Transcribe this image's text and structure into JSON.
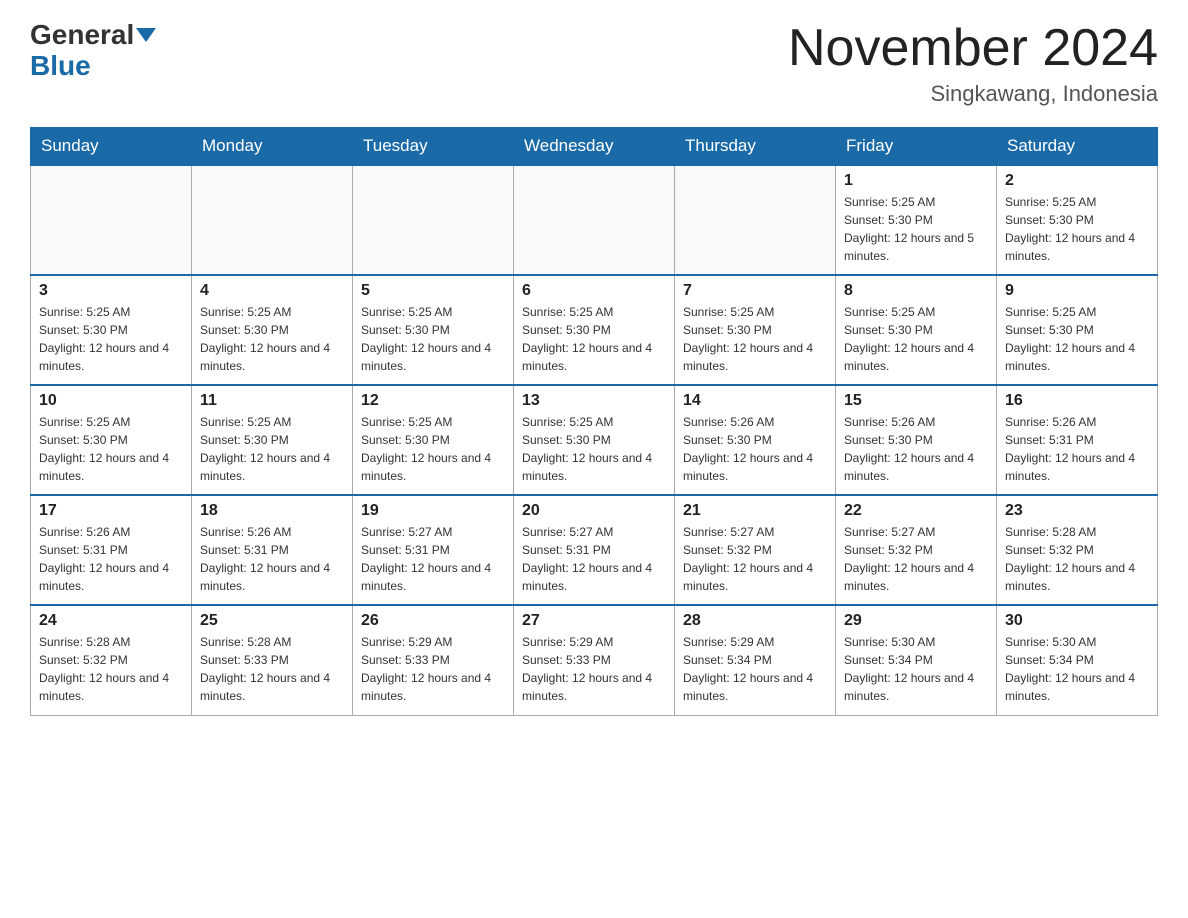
{
  "logo": {
    "general": "General",
    "blue": "Blue"
  },
  "header": {
    "title": "November 2024",
    "location": "Singkawang, Indonesia"
  },
  "weekdays": [
    "Sunday",
    "Monday",
    "Tuesday",
    "Wednesday",
    "Thursday",
    "Friday",
    "Saturday"
  ],
  "weeks": [
    [
      {
        "day": "",
        "sunrise": "",
        "sunset": "",
        "daylight": ""
      },
      {
        "day": "",
        "sunrise": "",
        "sunset": "",
        "daylight": ""
      },
      {
        "day": "",
        "sunrise": "",
        "sunset": "",
        "daylight": ""
      },
      {
        "day": "",
        "sunrise": "",
        "sunset": "",
        "daylight": ""
      },
      {
        "day": "",
        "sunrise": "",
        "sunset": "",
        "daylight": ""
      },
      {
        "day": "1",
        "sunrise": "Sunrise: 5:25 AM",
        "sunset": "Sunset: 5:30 PM",
        "daylight": "Daylight: 12 hours and 5 minutes."
      },
      {
        "day": "2",
        "sunrise": "Sunrise: 5:25 AM",
        "sunset": "Sunset: 5:30 PM",
        "daylight": "Daylight: 12 hours and 4 minutes."
      }
    ],
    [
      {
        "day": "3",
        "sunrise": "Sunrise: 5:25 AM",
        "sunset": "Sunset: 5:30 PM",
        "daylight": "Daylight: 12 hours and 4 minutes."
      },
      {
        "day": "4",
        "sunrise": "Sunrise: 5:25 AM",
        "sunset": "Sunset: 5:30 PM",
        "daylight": "Daylight: 12 hours and 4 minutes."
      },
      {
        "day": "5",
        "sunrise": "Sunrise: 5:25 AM",
        "sunset": "Sunset: 5:30 PM",
        "daylight": "Daylight: 12 hours and 4 minutes."
      },
      {
        "day": "6",
        "sunrise": "Sunrise: 5:25 AM",
        "sunset": "Sunset: 5:30 PM",
        "daylight": "Daylight: 12 hours and 4 minutes."
      },
      {
        "day": "7",
        "sunrise": "Sunrise: 5:25 AM",
        "sunset": "Sunset: 5:30 PM",
        "daylight": "Daylight: 12 hours and 4 minutes."
      },
      {
        "day": "8",
        "sunrise": "Sunrise: 5:25 AM",
        "sunset": "Sunset: 5:30 PM",
        "daylight": "Daylight: 12 hours and 4 minutes."
      },
      {
        "day": "9",
        "sunrise": "Sunrise: 5:25 AM",
        "sunset": "Sunset: 5:30 PM",
        "daylight": "Daylight: 12 hours and 4 minutes."
      }
    ],
    [
      {
        "day": "10",
        "sunrise": "Sunrise: 5:25 AM",
        "sunset": "Sunset: 5:30 PM",
        "daylight": "Daylight: 12 hours and 4 minutes."
      },
      {
        "day": "11",
        "sunrise": "Sunrise: 5:25 AM",
        "sunset": "Sunset: 5:30 PM",
        "daylight": "Daylight: 12 hours and 4 minutes."
      },
      {
        "day": "12",
        "sunrise": "Sunrise: 5:25 AM",
        "sunset": "Sunset: 5:30 PM",
        "daylight": "Daylight: 12 hours and 4 minutes."
      },
      {
        "day": "13",
        "sunrise": "Sunrise: 5:25 AM",
        "sunset": "Sunset: 5:30 PM",
        "daylight": "Daylight: 12 hours and 4 minutes."
      },
      {
        "day": "14",
        "sunrise": "Sunrise: 5:26 AM",
        "sunset": "Sunset: 5:30 PM",
        "daylight": "Daylight: 12 hours and 4 minutes."
      },
      {
        "day": "15",
        "sunrise": "Sunrise: 5:26 AM",
        "sunset": "Sunset: 5:30 PM",
        "daylight": "Daylight: 12 hours and 4 minutes."
      },
      {
        "day": "16",
        "sunrise": "Sunrise: 5:26 AM",
        "sunset": "Sunset: 5:31 PM",
        "daylight": "Daylight: 12 hours and 4 minutes."
      }
    ],
    [
      {
        "day": "17",
        "sunrise": "Sunrise: 5:26 AM",
        "sunset": "Sunset: 5:31 PM",
        "daylight": "Daylight: 12 hours and 4 minutes."
      },
      {
        "day": "18",
        "sunrise": "Sunrise: 5:26 AM",
        "sunset": "Sunset: 5:31 PM",
        "daylight": "Daylight: 12 hours and 4 minutes."
      },
      {
        "day": "19",
        "sunrise": "Sunrise: 5:27 AM",
        "sunset": "Sunset: 5:31 PM",
        "daylight": "Daylight: 12 hours and 4 minutes."
      },
      {
        "day": "20",
        "sunrise": "Sunrise: 5:27 AM",
        "sunset": "Sunset: 5:31 PM",
        "daylight": "Daylight: 12 hours and 4 minutes."
      },
      {
        "day": "21",
        "sunrise": "Sunrise: 5:27 AM",
        "sunset": "Sunset: 5:32 PM",
        "daylight": "Daylight: 12 hours and 4 minutes."
      },
      {
        "day": "22",
        "sunrise": "Sunrise: 5:27 AM",
        "sunset": "Sunset: 5:32 PM",
        "daylight": "Daylight: 12 hours and 4 minutes."
      },
      {
        "day": "23",
        "sunrise": "Sunrise: 5:28 AM",
        "sunset": "Sunset: 5:32 PM",
        "daylight": "Daylight: 12 hours and 4 minutes."
      }
    ],
    [
      {
        "day": "24",
        "sunrise": "Sunrise: 5:28 AM",
        "sunset": "Sunset: 5:32 PM",
        "daylight": "Daylight: 12 hours and 4 minutes."
      },
      {
        "day": "25",
        "sunrise": "Sunrise: 5:28 AM",
        "sunset": "Sunset: 5:33 PM",
        "daylight": "Daylight: 12 hours and 4 minutes."
      },
      {
        "day": "26",
        "sunrise": "Sunrise: 5:29 AM",
        "sunset": "Sunset: 5:33 PM",
        "daylight": "Daylight: 12 hours and 4 minutes."
      },
      {
        "day": "27",
        "sunrise": "Sunrise: 5:29 AM",
        "sunset": "Sunset: 5:33 PM",
        "daylight": "Daylight: 12 hours and 4 minutes."
      },
      {
        "day": "28",
        "sunrise": "Sunrise: 5:29 AM",
        "sunset": "Sunset: 5:34 PM",
        "daylight": "Daylight: 12 hours and 4 minutes."
      },
      {
        "day": "29",
        "sunrise": "Sunrise: 5:30 AM",
        "sunset": "Sunset: 5:34 PM",
        "daylight": "Daylight: 12 hours and 4 minutes."
      },
      {
        "day": "30",
        "sunrise": "Sunrise: 5:30 AM",
        "sunset": "Sunset: 5:34 PM",
        "daylight": "Daylight: 12 hours and 4 minutes."
      }
    ]
  ]
}
